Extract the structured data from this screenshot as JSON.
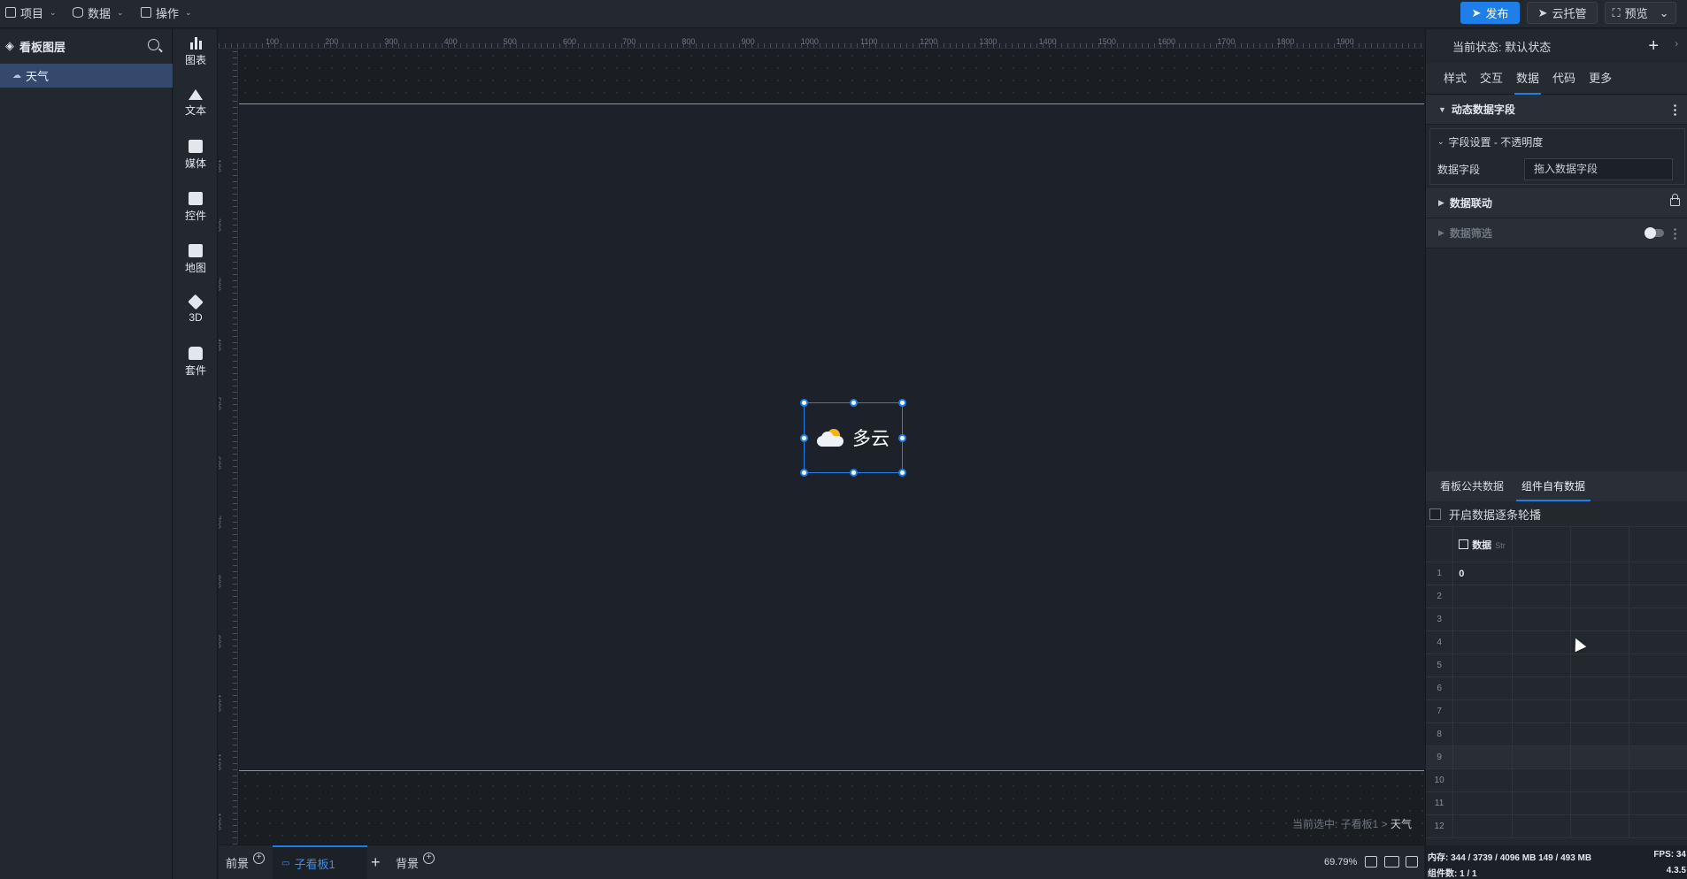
{
  "topbar": {
    "menus": [
      {
        "label": "项目"
      },
      {
        "label": "数据"
      },
      {
        "label": "操作"
      }
    ],
    "publish_label": "发布",
    "cloud_label": "云托管",
    "preview_label": "预览"
  },
  "layers": {
    "title": "看板图层",
    "items": [
      {
        "label": "天气"
      }
    ]
  },
  "components": [
    {
      "label": "图表",
      "icon": "bar-chart-icon"
    },
    {
      "label": "文本",
      "icon": "text-icon"
    },
    {
      "label": "媒体",
      "icon": "media-icon"
    },
    {
      "label": "控件",
      "icon": "control-icon"
    },
    {
      "label": "地图",
      "icon": "map-icon"
    },
    {
      "label": "3D",
      "icon": "cube-icon"
    },
    {
      "label": "套件",
      "icon": "shirt-icon"
    }
  ],
  "canvas": {
    "ruler_top": [
      "100",
      "200",
      "300",
      "400",
      "500",
      "600",
      "700",
      "800",
      "900",
      "1000",
      "1100",
      "1200",
      "1300",
      "1400",
      "1500",
      "1600",
      "1700",
      "1800",
      "1900"
    ],
    "ruler_left": [
      "100",
      "200",
      "300",
      "400",
      "500",
      "600",
      "700",
      "800",
      "900",
      "1000",
      "1100",
      "1200"
    ],
    "widget_text": "多云",
    "widget_icon": "partly-cloudy-icon",
    "selection_prefix": "当前选中: 子看板1 >",
    "selection_name": "天气"
  },
  "bottombar": {
    "tabs": [
      {
        "label": "前景"
      },
      {
        "label": "子看板1"
      },
      {
        "label": "背景"
      }
    ],
    "zoom": "69.79%"
  },
  "right_panel": {
    "state_label": "当前状态:  默认状态",
    "tabs": [
      "样式",
      "交互",
      "数据",
      "代码",
      "更多"
    ],
    "active_tab": "数据",
    "section_dynamic": "动态数据字段",
    "field_setting_title": "字段设置 - 不透明度",
    "data_field_label": "数据字段",
    "data_field_placeholder": "拖入数据字段",
    "section_linkage": "数据联动",
    "section_filter": "数据筛选",
    "data_tabs": [
      "看板公共数据",
      "组件自有数据"
    ],
    "carousel_label": "开启数据逐条轮播",
    "grid": {
      "column_header": "数据",
      "column_type": "Str",
      "rows": [
        "1",
        "2",
        "3",
        "4",
        "5",
        "6",
        "7",
        "8",
        "9",
        "10",
        "11",
        "12"
      ],
      "values": [
        "0",
        "",
        "",
        "",
        "",
        "",
        "",
        "",
        "",
        "",
        "",
        ""
      ]
    },
    "status": {
      "memory": "内存:  344 / 3739 / 4096 MB  149 / 493 MB",
      "fps": "FPS:  34",
      "components": "组件数: 1 / 1",
      "version": "4.3.5"
    }
  },
  "colors": {
    "accent": "#1f7fe8",
    "board": "#1c212a",
    "panel": "#23272e"
  }
}
